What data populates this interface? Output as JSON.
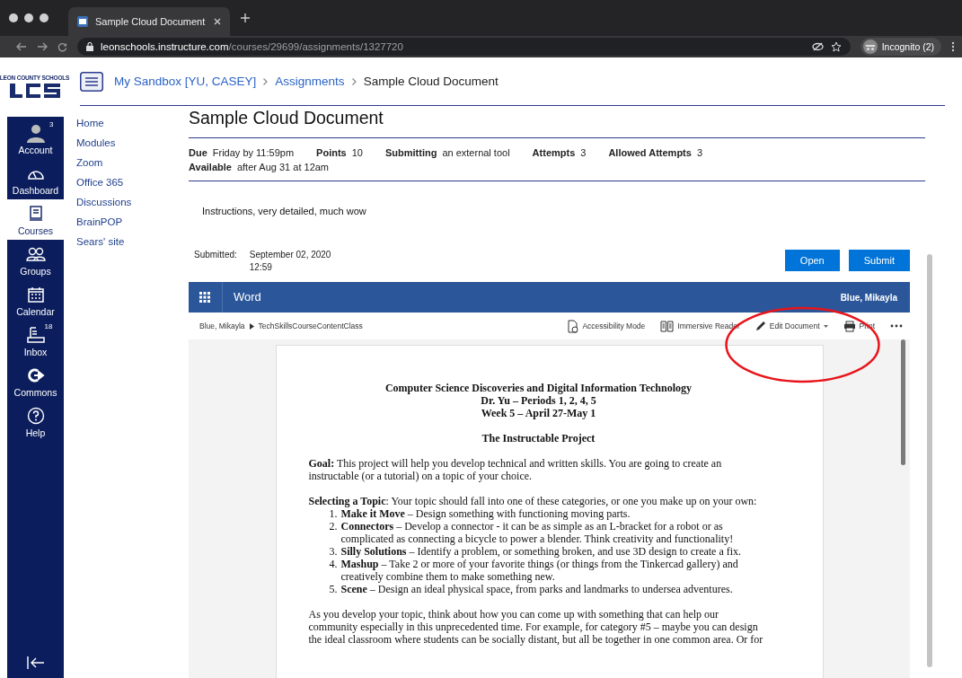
{
  "browser": {
    "tab_title": "Sample Cloud Document",
    "url_host": "leonschools.instructure.com",
    "url_path": "/courses/29699/assignments/1327720",
    "profile": "Incognito (2)"
  },
  "logo": {
    "caption": "LEON COUNTY SCHOOLS"
  },
  "global_nav": [
    {
      "kind": "account",
      "label": "Account",
      "badge": "3",
      "selected": false
    },
    {
      "kind": "dashboard",
      "label": "Dashboard",
      "selected": false
    },
    {
      "kind": "courses",
      "label": "Courses",
      "selected": true
    },
    {
      "kind": "groups",
      "label": "Groups",
      "selected": false
    },
    {
      "kind": "calendar",
      "label": "Calendar",
      "selected": false
    },
    {
      "kind": "inbox",
      "label": "Inbox",
      "badge": "18",
      "selected": false
    },
    {
      "kind": "commons",
      "label": "Commons",
      "selected": false
    },
    {
      "kind": "help",
      "label": "Help",
      "selected": false
    }
  ],
  "breadcrumbs": [
    "My Sandbox [YU, CASEY]",
    "Assignments",
    "Sample Cloud Document"
  ],
  "course_nav": [
    "Home",
    "Modules",
    "Zoom",
    "Office 365",
    "Discussions",
    "BrainPOP",
    "Sears' site"
  ],
  "assignment": {
    "title": "Sample Cloud Document",
    "details": [
      [
        {
          "label": "Due",
          "value": "Friday by 11:59pm"
        },
        {
          "label": "Points",
          "value": "10"
        },
        {
          "label": "Submitting",
          "value": "an external tool"
        },
        {
          "label": "Attempts",
          "value": "3"
        },
        {
          "label": "Allowed Attempts",
          "value": "3"
        }
      ],
      [
        {
          "label": "Available",
          "value": "after Aug 31 at 12am"
        }
      ]
    ],
    "instructions": "Instructions, very detailed, much wow"
  },
  "submission": {
    "label": "Submitted:",
    "date": "September 02, 2020",
    "time": "12:59",
    "buttons": [
      "Open",
      "Submit"
    ]
  },
  "word": {
    "app": "Word",
    "user": "Blue, Mikayla",
    "path": [
      "Blue, Mikayla",
      "TechSkillsCourseContentClass"
    ],
    "toolbar": [
      {
        "kind": "accessibility",
        "label": "Accessibility Mode"
      },
      {
        "kind": "reader",
        "label": "Immersive Reader"
      },
      {
        "kind": "edit",
        "label": "Edit Document",
        "dropdown": true
      },
      {
        "kind": "print",
        "label": "Print"
      },
      {
        "kind": "more"
      }
    ]
  },
  "document": [
    {
      "kind": "heading",
      "lines": [
        "Computer Science Discoveries and Digital Information Technology",
        "Dr. Yu – Periods 1, 2, 4, 5",
        "Week 5 – April 27-May 1"
      ]
    },
    {
      "kind": "heading",
      "lines": [
        "The Instructable Project"
      ]
    },
    {
      "kind": "paragraph",
      "text": "**Goal:** This project will help you develop technical and written skills.  You are going to create an instructable (or a tutorial) on a topic of your choice."
    },
    {
      "kind": "list",
      "intro": "**Selecting a Topic**: Your topic should fall into one of these categories, or one you make up on your own:",
      "items": [
        {
          "number": "1.",
          "text": "**Make it Move** – Design something with functioning moving parts."
        },
        {
          "number": "2.",
          "text": "**Connectors** – Develop a connector - it can be as simple as an L-bracket for a robot or as complicated as connecting a bicycle to power a blender. Think creativity and functionality!"
        },
        {
          "number": "3.",
          "text": "**Silly Solutions** – Identify a problem, or something broken, and use 3D design to create a fix."
        },
        {
          "number": "4.",
          "text": "**Mashup** – Take 2 or more of your favorite things (or things from the Tinkercad gallery) and creatively combine them to make something new."
        },
        {
          "number": "5.",
          "text": "**Scene** – Design an ideal physical space, from parks and landmarks to undersea adventures."
        }
      ]
    },
    {
      "kind": "paragraph",
      "text": "As you develop your topic, think about how you can come up with something that can help our community especially in this unprecedented time. For example, for category #5 – maybe you can design the ideal classroom where students can be socially distant, but all be together in one common area. Or for"
    }
  ],
  "annotation": {
    "kind": "ellipse",
    "color": "#e8141b"
  }
}
